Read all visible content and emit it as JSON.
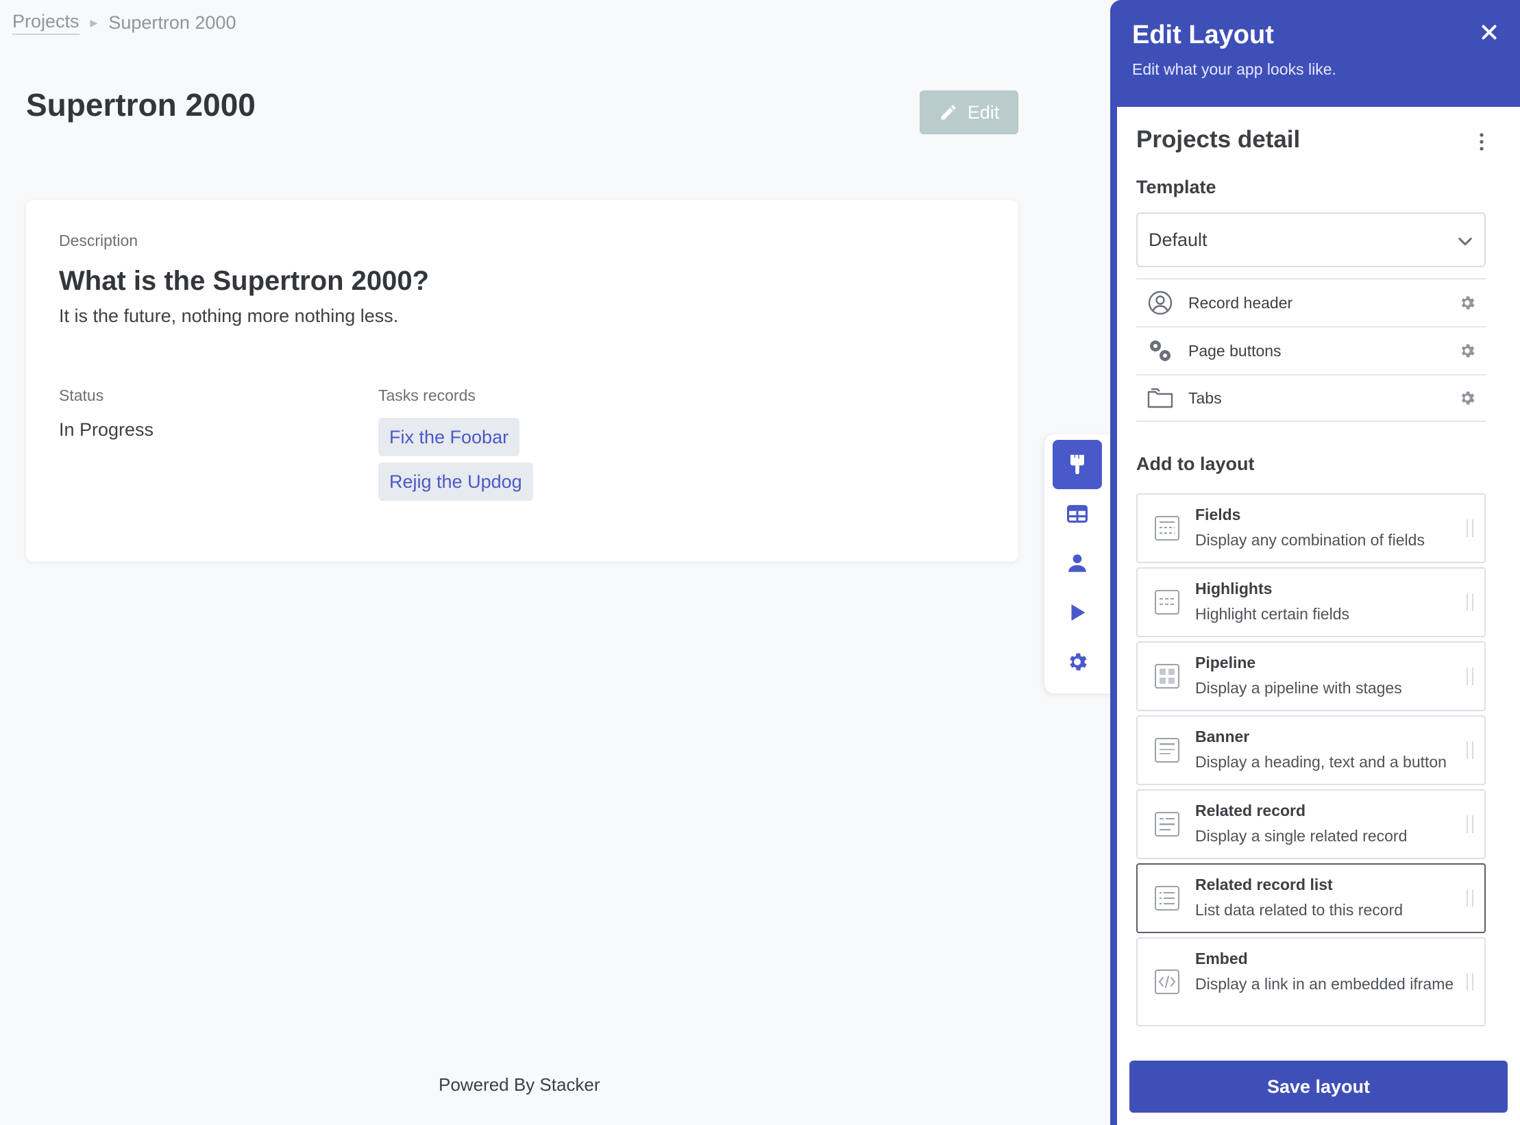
{
  "breadcrumb": {
    "root": "Projects",
    "current": "Supertron 2000"
  },
  "page": {
    "title": "Supertron 2000",
    "edit_label": "Edit"
  },
  "record": {
    "description_label": "Description",
    "description_heading": "What is the Supertron 2000?",
    "description_text": "It is the future, nothing more nothing less.",
    "status_label": "Status",
    "status_value": "In Progress",
    "tasks_label": "Tasks records",
    "tasks": [
      "Fix the Foobar",
      "Rejig the Updog"
    ]
  },
  "footer": {
    "powered": "Powered By Stacker"
  },
  "toolbar": {
    "items": [
      {
        "icon": "paintbrush-icon",
        "active": true
      },
      {
        "icon": "table-icon",
        "active": false
      },
      {
        "icon": "user-icon",
        "active": false
      },
      {
        "icon": "play-icon",
        "active": false
      },
      {
        "icon": "gear-icon",
        "active": false
      }
    ]
  },
  "panel": {
    "title": "Edit Layout",
    "subtitle": "Edit what your app looks like.",
    "heading": "Projects detail",
    "template_label": "Template",
    "template_value": "Default",
    "layout_items": [
      {
        "label": "Record header",
        "icon": "user-circle-icon"
      },
      {
        "label": "Page buttons",
        "icon": "gears-icon"
      },
      {
        "label": "Tabs",
        "icon": "folders-icon"
      }
    ],
    "add_label": "Add to layout",
    "blocks": [
      {
        "title": "Fields",
        "desc": "Display any combination of fields",
        "icon": "fields-block-icon"
      },
      {
        "title": "Highlights",
        "desc": "Highlight certain fields",
        "icon": "highlights-block-icon"
      },
      {
        "title": "Pipeline",
        "desc": "Display a pipeline with stages",
        "icon": "pipeline-block-icon"
      },
      {
        "title": "Banner",
        "desc": "Display a heading, text and a button",
        "icon": "banner-block-icon"
      },
      {
        "title": "Related record",
        "desc": "Display a single related record",
        "icon": "related-record-block-icon"
      },
      {
        "title": "Related record list",
        "desc": "List data related to this record",
        "icon": "related-list-block-icon"
      },
      {
        "title": "Embed",
        "desc": "Display a link in an embedded iframe",
        "icon": "embed-block-icon"
      }
    ],
    "save_label": "Save layout"
  },
  "colors": {
    "accent": "#4a59c9",
    "panel": "#3f4fb8",
    "edit_button": "#b9cbcb"
  }
}
